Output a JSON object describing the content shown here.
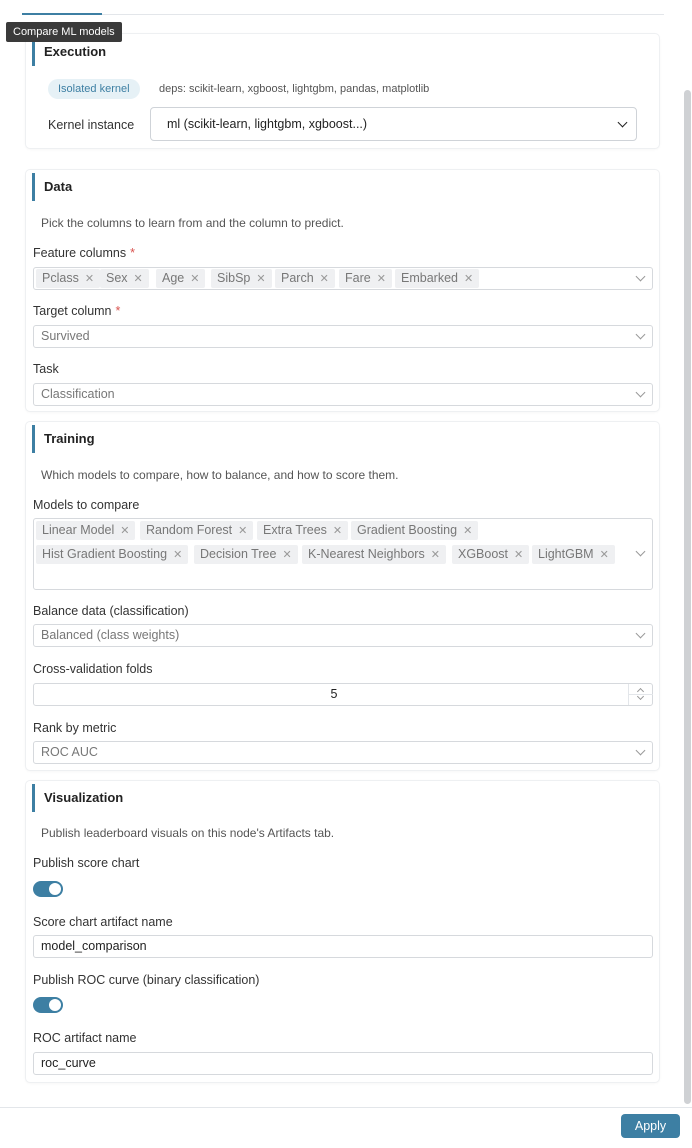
{
  "tooltip": "Compare ML models",
  "execution": {
    "title": "Execution",
    "badge": "Isolated kernel",
    "deps": "deps: scikit-learn, xgboost, lightgbm, pandas, matplotlib",
    "kernel_label": "Kernel instance",
    "kernel_value": "ml (scikit-learn, lightgbm, xgboost...)"
  },
  "data": {
    "title": "Data",
    "description": "Pick the columns to learn from and the column to predict.",
    "feature_label": "Feature columns",
    "required_mark": "*",
    "features": [
      "Pclass",
      "Sex",
      "Age",
      "SibSp",
      "Parch",
      "Fare",
      "Embarked"
    ],
    "target_label": "Target column",
    "target_value": "Survived",
    "task_label": "Task",
    "task_value": "Classification"
  },
  "training": {
    "title": "Training",
    "description": "Which models to compare, how to balance, and how to score them.",
    "models_label": "Models to compare",
    "models": [
      "Linear Model",
      "Random Forest",
      "Extra Trees",
      "Gradient Boosting",
      "Hist Gradient Boosting",
      "Decision Tree",
      "K-Nearest Neighbors",
      "XGBoost",
      "LightGBM"
    ],
    "balance_label": "Balance data (classification)",
    "balance_value": "Balanced (class weights)",
    "cv_label": "Cross-validation folds",
    "cv_value": "5",
    "rank_label": "Rank by metric",
    "rank_value": "ROC AUC"
  },
  "visualization": {
    "title": "Visualization",
    "description": "Publish leaderboard visuals on this node's Artifacts tab.",
    "score_chart_label": "Publish score chart",
    "score_chart_on": true,
    "score_name_label": "Score chart artifact name",
    "score_name_value": "model_comparison",
    "roc_label": "Publish ROC curve (binary classification)",
    "roc_on": true,
    "roc_name_label": "ROC artifact name",
    "roc_name_value": "roc_curve"
  },
  "footer": {
    "apply_label": "Apply"
  }
}
